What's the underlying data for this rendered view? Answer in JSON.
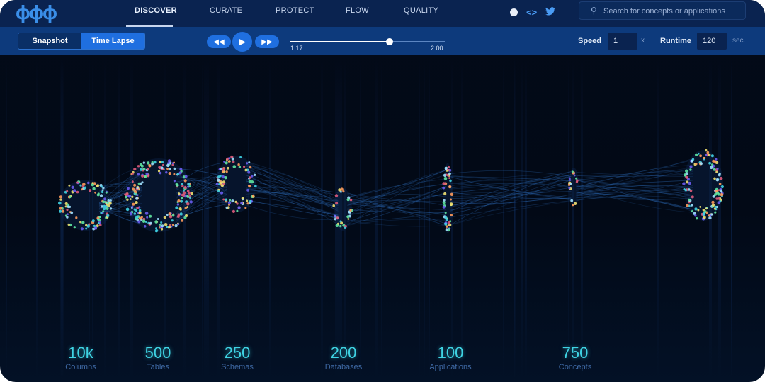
{
  "logo": "ϕϕϕ",
  "nav": {
    "items": [
      {
        "label": "DISCOVER",
        "active": true
      },
      {
        "label": "CURATE",
        "active": false
      },
      {
        "label": "PROTECT",
        "active": false
      },
      {
        "label": "FLOW",
        "active": false
      },
      {
        "label": "QUALITY",
        "active": false
      }
    ],
    "icons": [
      "dot-icon",
      "code-icon",
      "twitter-icon"
    ],
    "search_placeholder": "Search for concepts or applications"
  },
  "controls": {
    "mode_snapshot": "Snapshot",
    "mode_timelapse": "Time Lapse",
    "active_mode": "Time Lapse",
    "rewind_symbol": "◀◀",
    "play_symbol": "▶",
    "forward_symbol": "▶▶",
    "current_time": "1:17",
    "total_time": "2:00",
    "progress": 0.64,
    "speed_label": "Speed",
    "speed_value": "1",
    "speed_unit": "x",
    "runtime_label": "Runtime",
    "runtime_value": "120",
    "runtime_unit": "sec."
  },
  "stats": [
    {
      "value": "10k",
      "label": "Columns"
    },
    {
      "value": "500",
      "label": "Tables"
    },
    {
      "value": "250",
      "label": "Schemas"
    },
    {
      "value": "200",
      "label": "Databases"
    },
    {
      "value": "100",
      "label": "Applications"
    },
    {
      "value": "750",
      "label": "Concepts"
    }
  ],
  "colors": {
    "nav_bg": "#0a2350",
    "control_bg": "#0d3a7c",
    "accent": "#1f6fe0",
    "stat_value": "#3fd3e3",
    "stat_label": "#3f6aa6",
    "node_palette": [
      "#3fd3e3",
      "#5fe6a0",
      "#e05a7a",
      "#6a5cf0",
      "#f0e070",
      "#a0e0ff",
      "#ff9a5a"
    ]
  }
}
